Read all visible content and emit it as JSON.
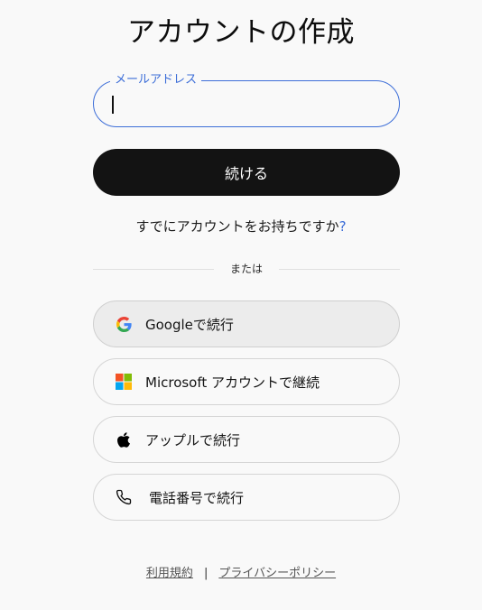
{
  "page": {
    "title": "アカウントの作成"
  },
  "email_field": {
    "label": "メールアドレス",
    "value": "",
    "placeholder": ""
  },
  "continue_button": {
    "label": "続ける"
  },
  "login_prompt": {
    "text": "すでにアカウントをお持ちですか",
    "link": "?"
  },
  "divider": {
    "label": "または"
  },
  "social": {
    "google": {
      "label": "Googleで続行",
      "icon": "google-icon"
    },
    "microsoft": {
      "label": "Microsoft アカウントで継続",
      "icon": "microsoft-icon"
    },
    "apple": {
      "label": "アップルで続行",
      "icon": "apple-icon"
    },
    "phone": {
      "label": "電話番号で続行",
      "icon": "phone-icon"
    }
  },
  "footer": {
    "terms": "利用規約",
    "separator": "|",
    "privacy": "プライバシーポリシー"
  },
  "colors": {
    "accent": "#3d6ed8",
    "primary_button": "#131313",
    "background": "#f9f9f9"
  }
}
